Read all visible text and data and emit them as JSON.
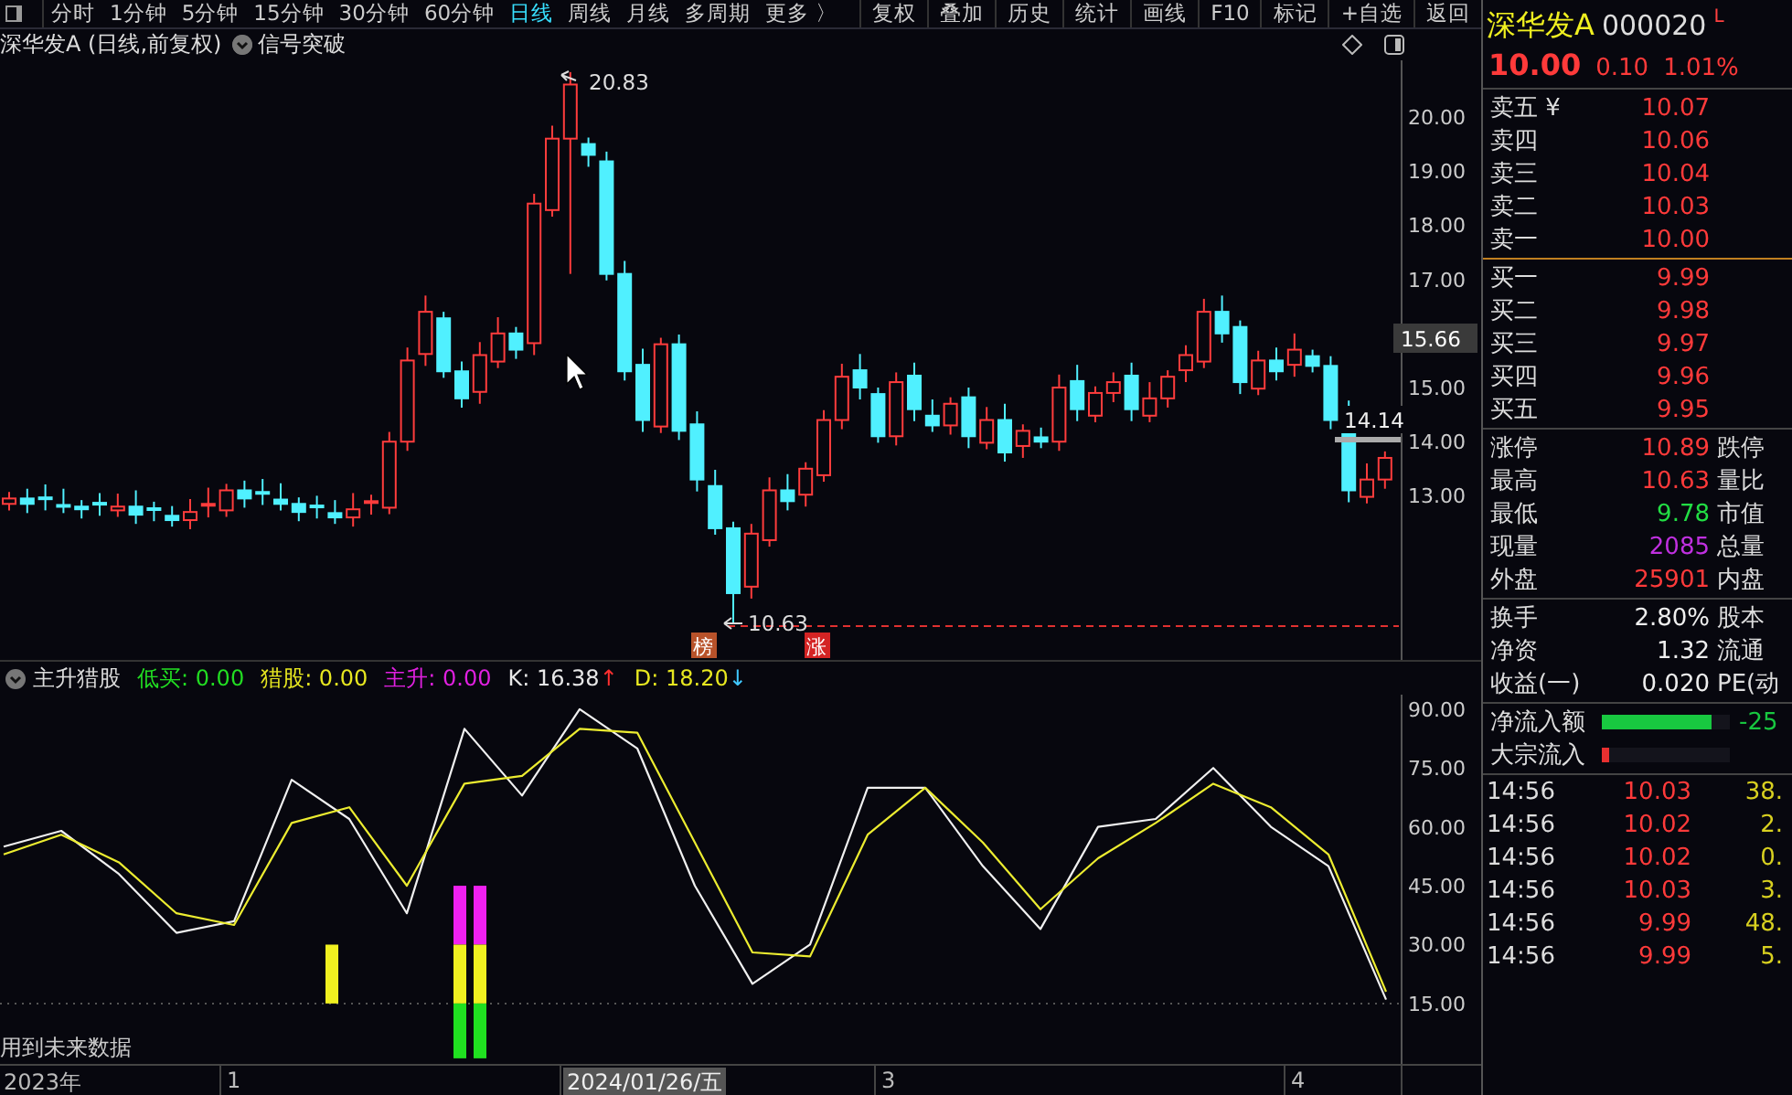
{
  "toolbar": {
    "periods": [
      {
        "label": "分时",
        "selected": false
      },
      {
        "label": "1分钟",
        "selected": false
      },
      {
        "label": "5分钟",
        "selected": false
      },
      {
        "label": "15分钟",
        "selected": false
      },
      {
        "label": "30分钟",
        "selected": false
      },
      {
        "label": "60分钟",
        "selected": false
      },
      {
        "label": "日线",
        "selected": true
      },
      {
        "label": "周线",
        "selected": false
      },
      {
        "label": "月线",
        "selected": false
      },
      {
        "label": "多周期",
        "selected": false
      },
      {
        "label": "更多 〉",
        "selected": false
      }
    ],
    "buttons": [
      "复权",
      "叠加",
      "历史",
      "统计",
      "画线",
      "F10",
      "标记",
      "+自选",
      "返回"
    ]
  },
  "chart_title": {
    "security": "深华发A (日线,前复权)",
    "indicator": "信号突破"
  },
  "price_pane": {
    "y_ticks": [
      "20.00",
      "19.00",
      "18.00",
      "17.00",
      "15.00",
      "14.00",
      "13.00"
    ],
    "high_label": "20.83",
    "low_label": "10.63",
    "last_price": "15.66",
    "marker_price": "14.14",
    "badges": [
      {
        "text": "榜",
        "color": "#b8522a"
      },
      {
        "text": "涨",
        "color": "#d42424"
      }
    ]
  },
  "indicator": {
    "name": "主升猎股",
    "readings": [
      {
        "label": "低买: 0.00",
        "color": "#22dd22"
      },
      {
        "label": "猎股: 0.00",
        "color": "#e8e820"
      },
      {
        "label": "主升: 0.00",
        "color": "#e020e0"
      },
      {
        "label": "K: 16.38",
        "color": "#e8e8e8",
        "arrow": {
          "text": "↑",
          "color": "#ff3030"
        }
      },
      {
        "label": "D: 18.20",
        "color": "#e8e820",
        "arrow": {
          "text": "↓",
          "color": "#40c8ff"
        }
      }
    ],
    "note": "用到未来数据",
    "chart_data": {
      "type": "line",
      "ylim": [
        -0.4,
        93.7
      ],
      "categories": [
        null,
        null,
        null,
        null,
        null,
        null,
        null,
        null,
        null,
        null,
        null,
        null,
        null,
        null,
        null,
        null,
        null,
        null,
        null,
        null,
        null,
        null,
        null,
        null,
        null
      ],
      "series": [
        {
          "color": "#f0f0f0",
          "values": [
            55,
            59,
            48,
            33,
            36,
            72,
            62,
            38,
            85,
            68,
            90,
            80,
            45,
            20,
            30,
            70,
            70,
            50,
            34,
            60,
            62,
            75,
            60,
            50,
            16
          ]
        },
        {
          "color": "#ecec30",
          "values": [
            53,
            58,
            51,
            38,
            35,
            61,
            65,
            45,
            71,
            73,
            85,
            84,
            56,
            28,
            27,
            58,
            70,
            56,
            39,
            52,
            61,
            71,
            65,
            53,
            18
          ]
        }
      ],
      "yticks": [
        {
          "value": 90,
          "label": "90.00"
        },
        {
          "value": 75,
          "label": "75.00"
        },
        {
          "value": 60,
          "label": "60.00"
        },
        {
          "value": 45,
          "label": "45.00"
        },
        {
          "value": 30,
          "label": "30.00"
        },
        {
          "value": 15,
          "label": "15.00"
        }
      ]
    }
  },
  "time_axis": [
    {
      "label": "2023年",
      "selected": false
    },
    {
      "label": "1",
      "selected": false
    },
    {
      "label": "2024/01/26/五",
      "selected": true
    },
    {
      "label": "3",
      "selected": false
    },
    {
      "label": "4",
      "selected": false
    }
  ],
  "quote": {
    "name": "深华发A",
    "code": "000020",
    "flag": "L",
    "price": "10.00",
    "change": "0.10",
    "change_pct": "1.01%",
    "asks": [
      {
        "label": "卖五 ¥",
        "price": "10.07"
      },
      {
        "label": "卖四",
        "price": "10.06"
      },
      {
        "label": "卖三",
        "price": "10.04"
      },
      {
        "label": "卖二",
        "price": "10.03"
      },
      {
        "label": "卖一",
        "price": "10.00"
      }
    ],
    "bids": [
      {
        "label": "买一",
        "price": "9.99"
      },
      {
        "label": "买二",
        "price": "9.98"
      },
      {
        "label": "买三",
        "price": "9.97"
      },
      {
        "label": "买四",
        "price": "9.96"
      },
      {
        "label": "买五",
        "price": "9.95"
      }
    ],
    "stats": [
      {
        "label": "涨停",
        "value": "10.89",
        "label_2": "跌停",
        "color": "#ff3a3a"
      },
      {
        "label": "最高",
        "value": "10.63",
        "label_2": "量比",
        "color": "#ff3a3a"
      },
      {
        "label": "最低",
        "value": "9.78",
        "label_2": "市值",
        "color": "#22dd44"
      },
      {
        "label": "现量",
        "value": "2085",
        "label_2": "总量",
        "color": "#c030e0"
      },
      {
        "label": "外盘",
        "value": "25901",
        "label_2": "内盘",
        "color": "#ff3a3a"
      }
    ],
    "fundamentals": [
      {
        "label": "换手",
        "value": "2.80%",
        "label_2": "股本"
      },
      {
        "label": "净资",
        "value": "1.32",
        "label_2": "流通"
      },
      {
        "label": "收益(一)",
        "value": "0.020",
        "label_2": "PE(动"
      }
    ],
    "flows": [
      {
        "label": "净流入额",
        "level": 0.85,
        "color": "#18c840",
        "value": "-25"
      },
      {
        "label": "大宗流入",
        "level": 0.05,
        "color": "#e83030"
      }
    ],
    "ticks": [
      {
        "time": "14:56",
        "price": "10.03",
        "volume": "38."
      },
      {
        "time": "14:56",
        "price": "10.02",
        "volume": "2."
      },
      {
        "time": "14:56",
        "price": "10.02",
        "volume": "0."
      },
      {
        "time": "14:56",
        "price": "10.03",
        "volume": "3."
      },
      {
        "time": "14:56",
        "price": "9.99",
        "volume": "48."
      },
      {
        "time": "14:56",
        "price": "9.99",
        "volume": "5."
      }
    ]
  }
}
